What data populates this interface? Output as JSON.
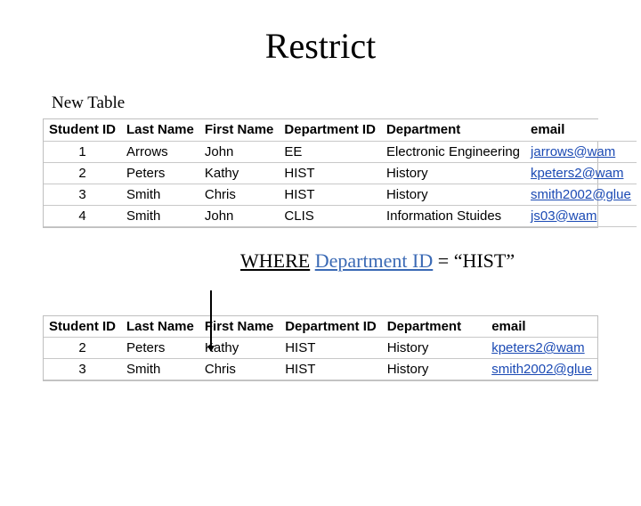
{
  "title": "Restrict",
  "subtitle": "New Table",
  "headers": {
    "student_id": "Student ID",
    "last_name": "Last Name",
    "first_name": "First Name",
    "dept_id": "Department ID",
    "department": "Department",
    "email": "email"
  },
  "table1": {
    "rows": [
      {
        "id": "1",
        "ln": "Arrows",
        "fn": "John",
        "did": "EE",
        "dep": "Electronic Engineering",
        "em": "jarrows@wam"
      },
      {
        "id": "2",
        "ln": "Peters",
        "fn": "Kathy",
        "did": "HIST",
        "dep": "History",
        "em": "kpeters2@wam"
      },
      {
        "id": "3",
        "ln": "Smith",
        "fn": "Chris",
        "did": "HIST",
        "dep": "History",
        "em": "smith2002@glue"
      },
      {
        "id": "4",
        "ln": "Smith",
        "fn": "John",
        "did": "CLIS",
        "dep": "Information Stuides",
        "em": "js03@wam"
      }
    ]
  },
  "query": {
    "where": "WHERE",
    "field": "Department ID",
    "eq": " = ",
    "value": "“HIST”"
  },
  "table2": {
    "rows": [
      {
        "id": "2",
        "ln": "Peters",
        "fn": "Kathy",
        "did": "HIST",
        "dep": "History",
        "em": "kpeters2@wam"
      },
      {
        "id": "3",
        "ln": "Smith",
        "fn": "Chris",
        "did": "HIST",
        "dep": "History",
        "em": "smith2002@glue"
      }
    ]
  }
}
